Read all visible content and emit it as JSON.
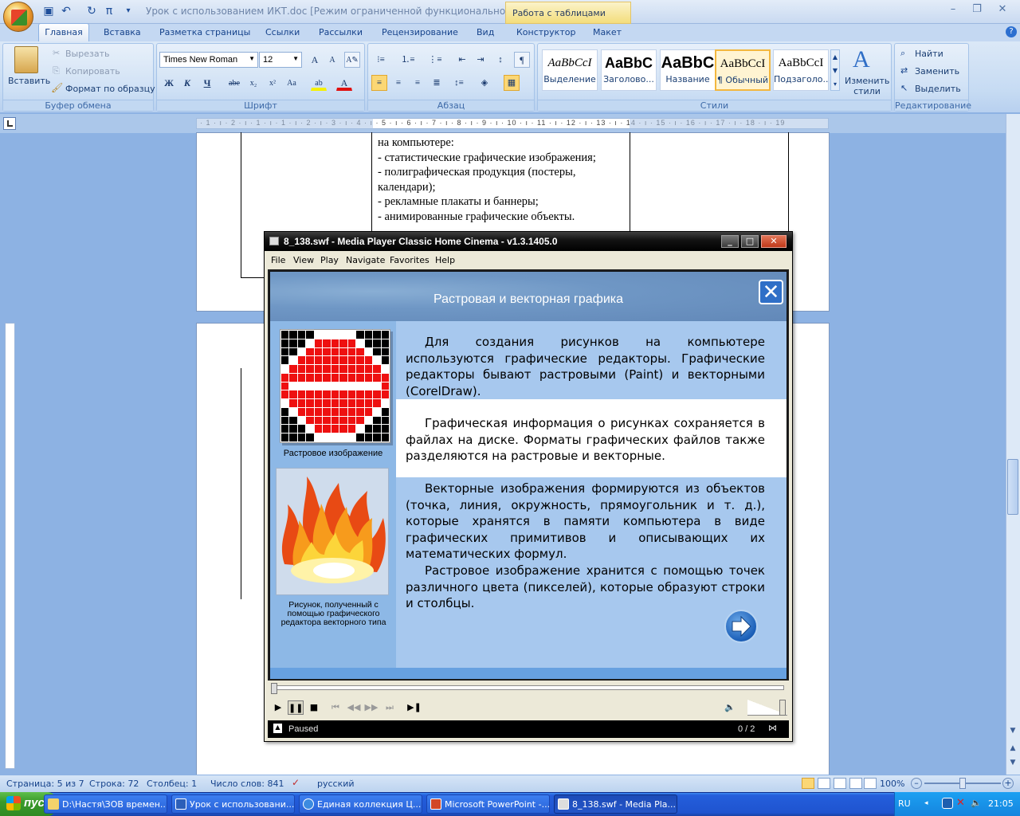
{
  "window": {
    "title": "Урок с использованием ИКТ.doc [Режим ограниченной функциональности] - М",
    "context_tab_group": "Работа с таблицами"
  },
  "ribbon_tabs": [
    "Главная",
    "Вставка",
    "Разметка страницы",
    "Ссылки",
    "Рассылки",
    "Рецензирование",
    "Вид",
    "Конструктор",
    "Макет"
  ],
  "clipboard": {
    "paste": "Вставить",
    "cut": "Вырезать",
    "copy": "Копировать",
    "format_painter": "Формат по образцу",
    "label": "Буфер обмена"
  },
  "font": {
    "family": "Times New Roman",
    "size": "12",
    "label": "Шрифт",
    "bold": "Ж",
    "italic": "К",
    "underline": "Ч",
    "strike": "abe",
    "sub": "x₂",
    "sup": "x²",
    "case": "Aa",
    "grow": "A",
    "shrink": "A"
  },
  "paragraph": {
    "label": "Абзац"
  },
  "styles": {
    "label": "Стили",
    "items": [
      {
        "sample": "AaBbCcI",
        "name": "Выделение"
      },
      {
        "sample": "AaBbC",
        "name": "Заголово..."
      },
      {
        "sample": "AaBbC",
        "name": "Название"
      },
      {
        "sample": "AaBbCcI",
        "name": "¶ Обычный"
      },
      {
        "sample": "AaBbCcI",
        "name": "Подзаголо..."
      }
    ],
    "change": "Изменить стили"
  },
  "editing": {
    "find": "Найти",
    "replace": "Заменить",
    "select": "Выделить",
    "label": "Редактирование"
  },
  "ruler_text": "· 1 · ı · 2 · ı · 1 · ı · 1 · ı · 2 · ı · 3 · ı · 4 · ı · 5 · ı · 6 · ı · 7 · ı · 8 · ı · 9 · ı · 10 · ı · 11 · ı · 12 · ı · 13 · ı · 14 · ı · 15 · ı · 16 · ı · 17 · ı · 18 · ı · 19",
  "document_text": [
    "на компьютере:",
    "- статистические графические изображения;",
    "- полиграфическая продукция (постеры, календари);",
    "- рекламные плакаты и баннеры;",
    "- анимированные графические объекты."
  ],
  "statusbar": {
    "page": "Страница: 5 из 7",
    "line": "Строка: 72",
    "column": "Столбец: 1",
    "words": "Число слов: 841",
    "language": "русский",
    "zoom": "100%"
  },
  "mpc": {
    "title": "8_138.swf - Media Player Classic Home Cinema - v1.3.1405.0",
    "menu": [
      "File",
      "View",
      "Play",
      "Navigate",
      "Favorites",
      "Help"
    ],
    "status": "Paused",
    "counter": "0 / 2"
  },
  "flash": {
    "title": "Растровая и векторная графика",
    "para1": "Для создания рисунков на компьютере используются графические редакторы. Графические редакторы бывают растровыми (Paint) и векторными (CorelDraw).",
    "para2": "Графическая информация о рисунках сохраняется в файлах на диске. Форматы графических файлов также разделяются на растровые и векторные.",
    "para3": "Векторные изображения формируются из объектов (точка, линия, окружность, прямоугольник и т. д.), которые хранятся в памяти компьютера в виде графических примитивов и описывающих их математических формул.",
    "para4": "Растровое изображение хранится с помощью точек различного цвета (пикселей), которые образуют строки и столбцы.",
    "caption_raster": "Растровое изображение",
    "caption_vector": "Рисунок, полученный с помощью графического редактора векторного типа"
  },
  "taskbar": {
    "start": "пуск",
    "items": [
      "D:\\Настя\\ЗОВ времен...",
      "Урок с использовани...",
      "Единая коллекция Ц...",
      "Microsoft PowerPoint -...",
      "8_138.swf - Media Pla..."
    ],
    "lang": "RU",
    "clock": "21:05"
  }
}
